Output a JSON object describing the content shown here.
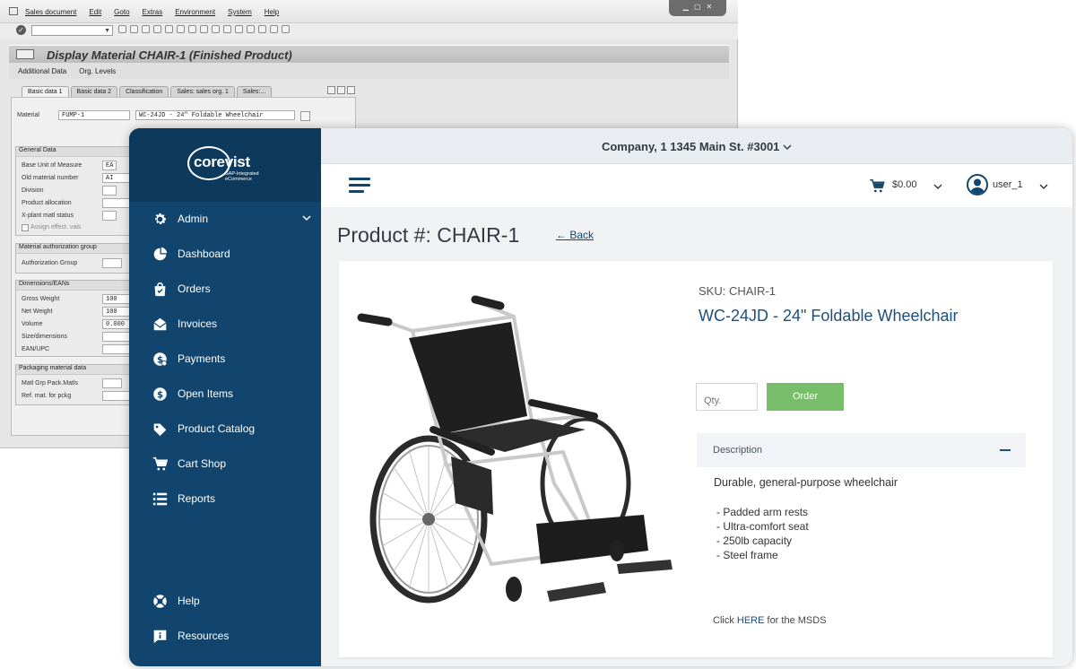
{
  "sap": {
    "menu": [
      "Sales document",
      "Edit",
      "Goto",
      "Extras",
      "Environment",
      "System",
      "Help"
    ],
    "title": "Display Material CHAIR-1 (Finished Product)",
    "app_toolbar": [
      "Additional Data",
      "Org. Levels"
    ],
    "tabs": [
      "Basic data 1",
      "Basic data 2",
      "Classification",
      "Sales: sales org. 1",
      "Sales:..."
    ],
    "material_label": "Material",
    "material_value": "FUMP-1",
    "material_desc": "WC-24JD - 24\" Foldable Wheelchair",
    "general_data": {
      "title": "General Data",
      "rows": [
        {
          "label": "Base Unit of Measure",
          "value": "EA"
        },
        {
          "label": "Old material number",
          "value": "AI"
        },
        {
          "label": "Division",
          "value": ""
        },
        {
          "label": "Product allocation",
          "value": ""
        },
        {
          "label": "X-plant matl status",
          "value": ""
        },
        {
          "label": "Assign effect. vals",
          "value": ""
        }
      ]
    },
    "auth_group": {
      "title": "Material authorization group",
      "label": "Authorization Group"
    },
    "dimensions": {
      "title": "Dimensions/EANs",
      "rows": [
        {
          "label": "Gross Weight",
          "value": "100"
        },
        {
          "label": "Net Weight",
          "value": "100"
        },
        {
          "label": "Volume",
          "value": "0.000"
        },
        {
          "label": "Size/dimensions",
          "value": ""
        },
        {
          "label": "EAN/UPC",
          "value": ""
        }
      ]
    },
    "packaging": {
      "title": "Packaging material data",
      "rows": [
        {
          "label": "Matl Grp Pack.Matls",
          "value": ""
        },
        {
          "label": "Ref. mat. for pckg",
          "value": ""
        }
      ]
    }
  },
  "brand": {
    "name": "corevist",
    "tagline_1": "SAP-Integrated",
    "tagline_2": "eCommerce"
  },
  "sidebar": {
    "items": [
      {
        "label": "Admin",
        "icon": "gear-icon"
      },
      {
        "label": "Dashboard",
        "icon": "pie-chart-icon"
      },
      {
        "label": "Orders",
        "icon": "shopping-bag-icon"
      },
      {
        "label": "Invoices",
        "icon": "envelope-icon"
      },
      {
        "label": "Payments",
        "icon": "dollar-coin-icon"
      },
      {
        "label": "Open Items",
        "icon": "dollar-circle-icon"
      },
      {
        "label": "Product Catalog",
        "icon": "tag-icon"
      },
      {
        "label": "Cart Shop",
        "icon": "cart-icon"
      },
      {
        "label": "Reports",
        "icon": "list-icon"
      },
      {
        "label": "Help",
        "icon": "lifebuoy-icon"
      },
      {
        "label": "Resources",
        "icon": "info-flag-icon"
      }
    ]
  },
  "header": {
    "company": "Company, 1 1345 Main St. #3001",
    "cart_total": "$0.00",
    "user": "user_1"
  },
  "page": {
    "title": "Product #: CHAIR-1",
    "back": "Back"
  },
  "product": {
    "sku": "SKU: CHAIR-1",
    "name": "WC-24JD - 24\" Foldable Wheelchair",
    "qty_placeholder": "Qty.",
    "order_label": "Order",
    "description_title": "Description",
    "description": "Durable, general-purpose wheelchair",
    "features": [
      "- Padded arm rests",
      "- Ultra-comfort seat",
      "- 250lb capacity",
      "- Steel frame"
    ],
    "msds_prefix": "Click ",
    "msds_link": "HERE",
    "msds_suffix": " for the MSDS"
  },
  "colors": {
    "sidebar": "#12456e",
    "brand_bg": "#0d3a5c",
    "accent": "#1d4f79",
    "order_button": "#78bd69"
  }
}
